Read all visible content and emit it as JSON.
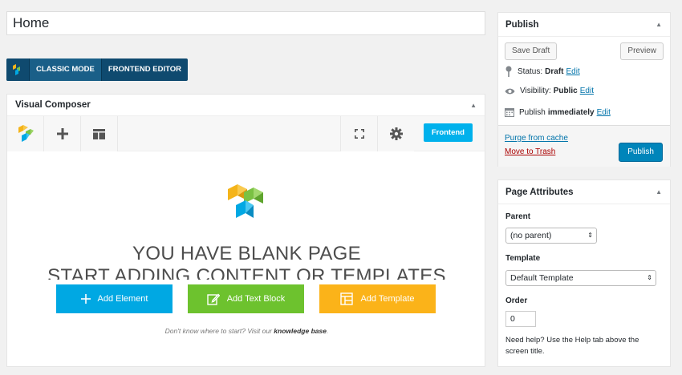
{
  "title_value": "Home",
  "modes": {
    "classic": "CLASSIC MODE",
    "frontend": "FRONTEND EDITOR"
  },
  "vc": {
    "title": "Visual Composer",
    "frontend_btn": "Frontend",
    "blank_line1": "YOU HAVE BLANK PAGE",
    "blank_line2": "START ADDING CONTENT OR TEMPLATES",
    "add_element": "Add Element",
    "add_text_block": "Add Text Block",
    "add_template": "Add Template",
    "hint_prefix": "Don't know where to start? Visit our ",
    "hint_link": "knowledge base",
    "hint_suffix": "."
  },
  "publish": {
    "title": "Publish",
    "save_draft": "Save Draft",
    "preview": "Preview",
    "status_label": "Status:",
    "status_value": "Draft",
    "visibility_label": "Visibility:",
    "visibility_value": "Public",
    "publish_label": "Publish",
    "publish_value": "immediately",
    "edit": "Edit",
    "purge": "Purge from cache",
    "trash": "Move to Trash",
    "publish_btn": "Publish"
  },
  "attributes": {
    "title": "Page Attributes",
    "parent_label": "Parent",
    "parent_value": "(no parent)",
    "template_label": "Template",
    "template_value": "Default Template",
    "order_label": "Order",
    "order_value": "0",
    "help": "Need help? Use the Help tab above the screen title."
  },
  "colors": {
    "accent": "#0085ba",
    "vc_blue": "#00a8e3",
    "vc_green": "#6dc22e",
    "vc_orange": "#fbb319",
    "trash": "#a00",
    "link": "#0073aa"
  }
}
